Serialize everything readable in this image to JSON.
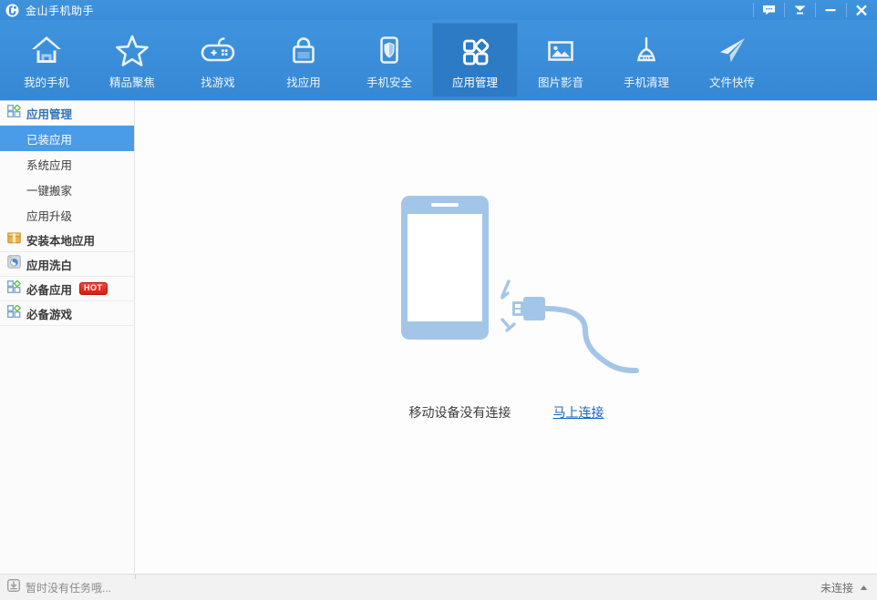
{
  "window": {
    "title": "金山手机助手",
    "logo_icon": "app-logo-icon",
    "controls": [
      {
        "name": "feedback-button",
        "icon": "speech-bubble-icon",
        "tooltip": "反馈"
      },
      {
        "name": "download-button",
        "icon": "download-arrow-icon",
        "tooltip": "下载"
      },
      {
        "name": "minimize-button",
        "icon": "minimize-icon",
        "tooltip": "最小化"
      },
      {
        "name": "close-button",
        "icon": "close-icon",
        "tooltip": "关闭"
      }
    ]
  },
  "navbar": {
    "active_index": 5,
    "items": [
      {
        "label": "我的手机",
        "icon": "home-icon"
      },
      {
        "label": "精品聚焦",
        "icon": "star-icon"
      },
      {
        "label": "找游戏",
        "icon": "gamepad-icon"
      },
      {
        "label": "找应用",
        "icon": "shopping-bag-icon"
      },
      {
        "label": "手机安全",
        "icon": "phone-shield-icon"
      },
      {
        "label": "应用管理",
        "icon": "app-squares-icon"
      },
      {
        "label": "图片影音",
        "icon": "picture-icon"
      },
      {
        "label": "手机清理",
        "icon": "broom-icon"
      },
      {
        "label": "文件快传",
        "icon": "paper-plane-icon"
      }
    ]
  },
  "sidebar": {
    "groups": [
      {
        "label": "应用管理",
        "icon": "app-squares-small-icon",
        "accent": "#2f74b5",
        "items": [
          {
            "label": "已装应用",
            "selected": true
          },
          {
            "label": "系统应用",
            "selected": false
          },
          {
            "label": "一键搬家",
            "selected": false
          },
          {
            "label": "应用升级",
            "selected": false
          }
        ]
      },
      {
        "label": "安装本地应用",
        "icon": "package-box-icon",
        "accent": "#3a3a3a",
        "items": []
      },
      {
        "label": "应用洗白",
        "icon": "washer-icon",
        "accent": "#3a3a3a",
        "items": []
      },
      {
        "label": "必备应用",
        "icon": "app-squares-small-icon",
        "accent": "#3a3a3a",
        "badge": "HOT",
        "items": []
      },
      {
        "label": "必备游戏",
        "icon": "app-squares-small-icon",
        "accent": "#3a3a3a",
        "items": []
      }
    ]
  },
  "content": {
    "empty_state": {
      "illustration": "disconnected-phone-usb-illustration",
      "message": "移动设备没有连接",
      "link_label": "马上连接"
    }
  },
  "statusbar": {
    "task_icon": "download-tray-icon",
    "task_text": "暂时没有任务哦...",
    "connection_status": "未连接",
    "caret_icon": "caret-up-icon"
  },
  "colors": {
    "brand_blue": "#3f93dd",
    "active_tab_blue": "#2d7bc4",
    "selected_item_blue": "#4a9be8",
    "link_blue": "#1767c4",
    "illustration_blue": "#9fc4e8",
    "hot_red": "#d81e12",
    "sidebar_bg": "#fbfbfb",
    "content_bg": "#fdfdfd",
    "statusbar_bg": "#f2f2f2"
  }
}
